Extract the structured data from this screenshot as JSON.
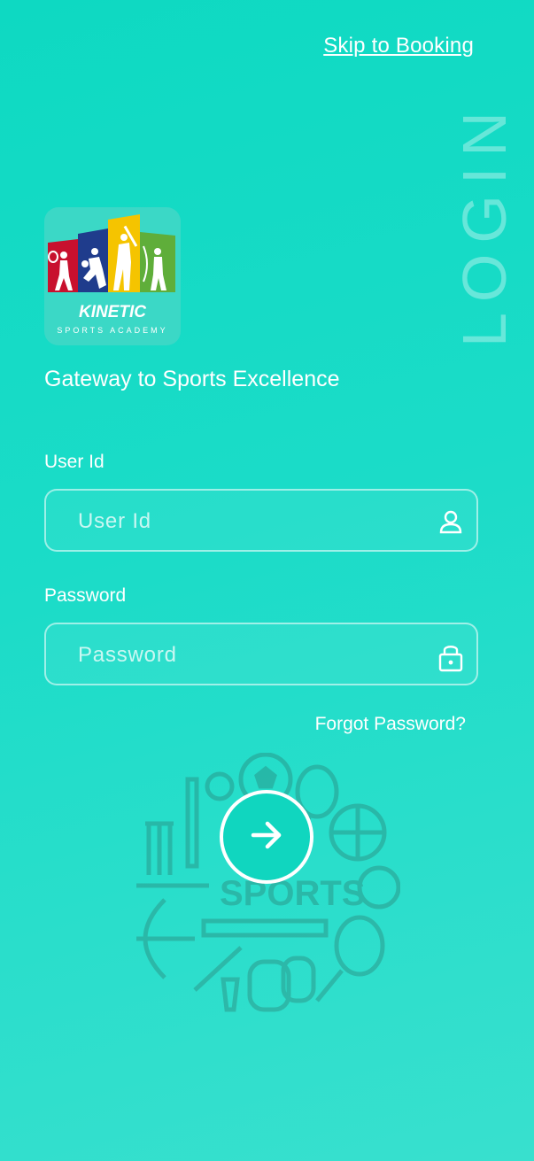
{
  "header": {
    "skip_label": "Skip to Booking"
  },
  "page": {
    "vertical_title": "LOGIN"
  },
  "brand": {
    "name": "KINETIC",
    "subtitle": "SPORTS ACADEMY",
    "tagline": "Gateway to Sports Excellence"
  },
  "form": {
    "user_id": {
      "label": "User Id",
      "placeholder": "User Id",
      "value": "",
      "icon": "user-icon"
    },
    "password": {
      "label": "Password",
      "placeholder": "Password",
      "value": "",
      "icon": "lock-icon"
    },
    "forgot_label": "Forgot Password?",
    "submit_icon": "arrow-right-icon"
  },
  "background_art": {
    "text": "SPORTS"
  },
  "colors": {
    "background_start": "#0ed9c2",
    "background_end": "#38e0ce",
    "accent": "#10d6bf",
    "text": "#ffffff"
  }
}
